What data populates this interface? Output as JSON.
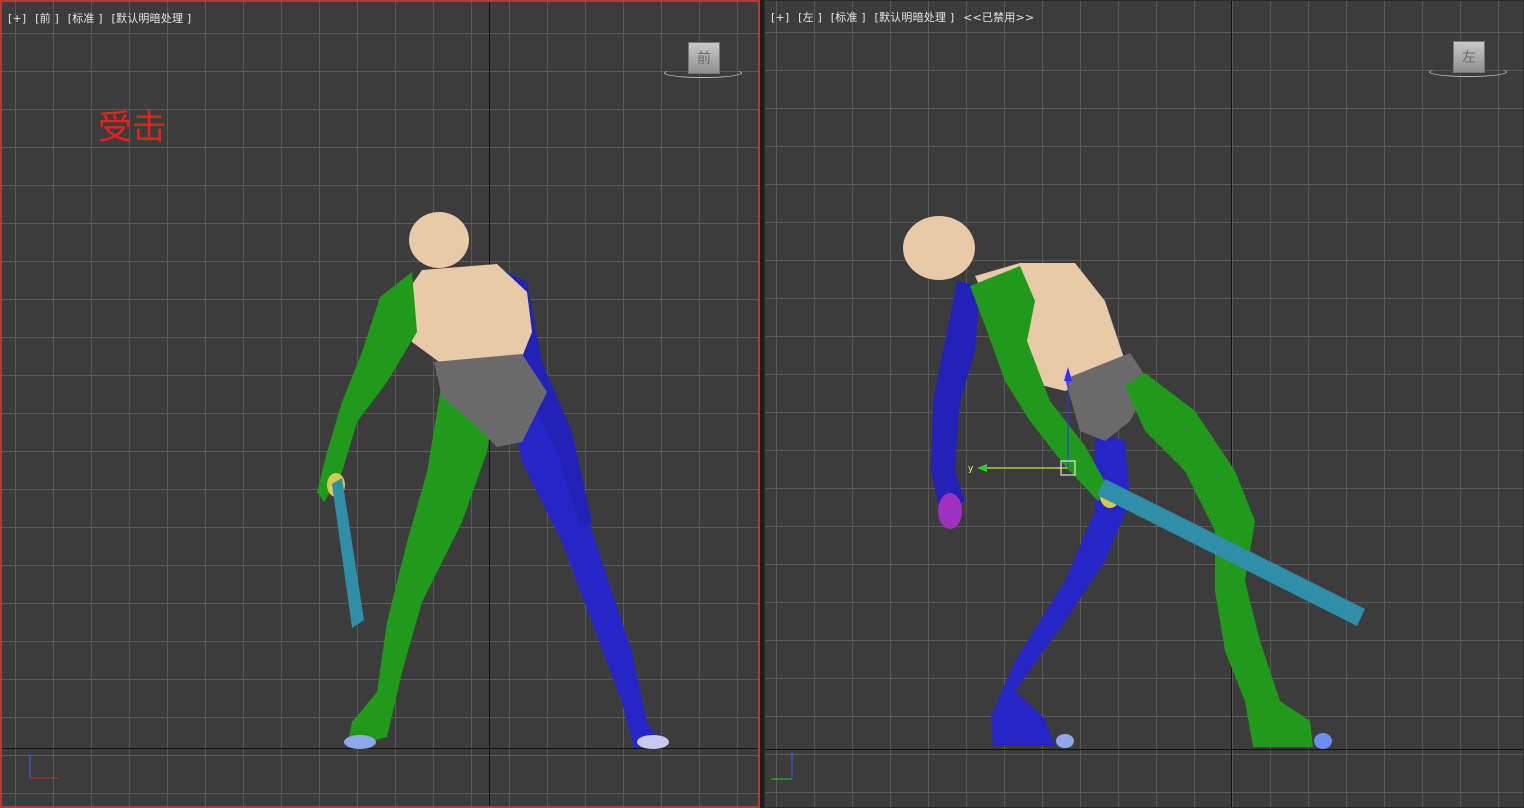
{
  "front_viewport": {
    "labels": [
      "[+]",
      "[前 ]",
      "[标准 ]",
      "[默认明暗处理 ]"
    ],
    "viewcube_face": "前",
    "annotation": "受击",
    "active": true
  },
  "left_viewport": {
    "labels": [
      "[+]",
      "[左 ]",
      "[标准 ]",
      "[默认明暗处理 ]"
    ],
    "disabled_text": "<<已禁用>>",
    "viewcube_face": "左",
    "gizmo_axis_label": "y",
    "active": false
  },
  "colors": {
    "active_border": "#b33a3a",
    "character_left_side": "#1f9a1a",
    "character_right_side": "#2626c8",
    "skin": "#e8c9a8",
    "pelvis": "#6a6a6a",
    "weapon": "#2f8fa8",
    "annotation": "#e8201e"
  },
  "icons": [
    "viewcube-front-icon",
    "viewcube-left-icon",
    "axis-tripod-icon",
    "move-gizmo-icon"
  ]
}
